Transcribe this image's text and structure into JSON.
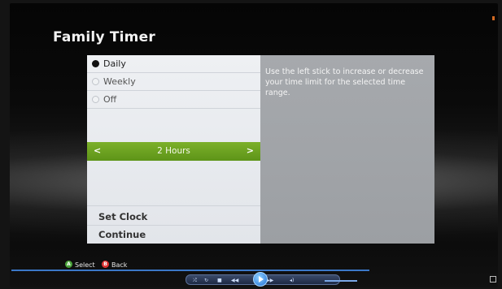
{
  "screen": {
    "title": "Family Timer"
  },
  "menu": {
    "options": [
      {
        "label": "Daily",
        "selected": true
      },
      {
        "label": "Weekly",
        "selected": false
      },
      {
        "label": "Off",
        "selected": false
      }
    ],
    "slider": {
      "left_icon": "<",
      "value": "2 Hours",
      "right_icon": ">"
    },
    "bottom_items": [
      {
        "label": "Set Clock"
      },
      {
        "label": "Continue"
      }
    ]
  },
  "description": "Use the left stick to increase or decrease your time limit for the selected time range.",
  "hints": {
    "select_button": "A",
    "select_label": "Select",
    "back_button": "B",
    "back_label": "Back"
  },
  "colors": {
    "accent_green": "#6aa321",
    "hint_blue": "#3b78c8"
  }
}
